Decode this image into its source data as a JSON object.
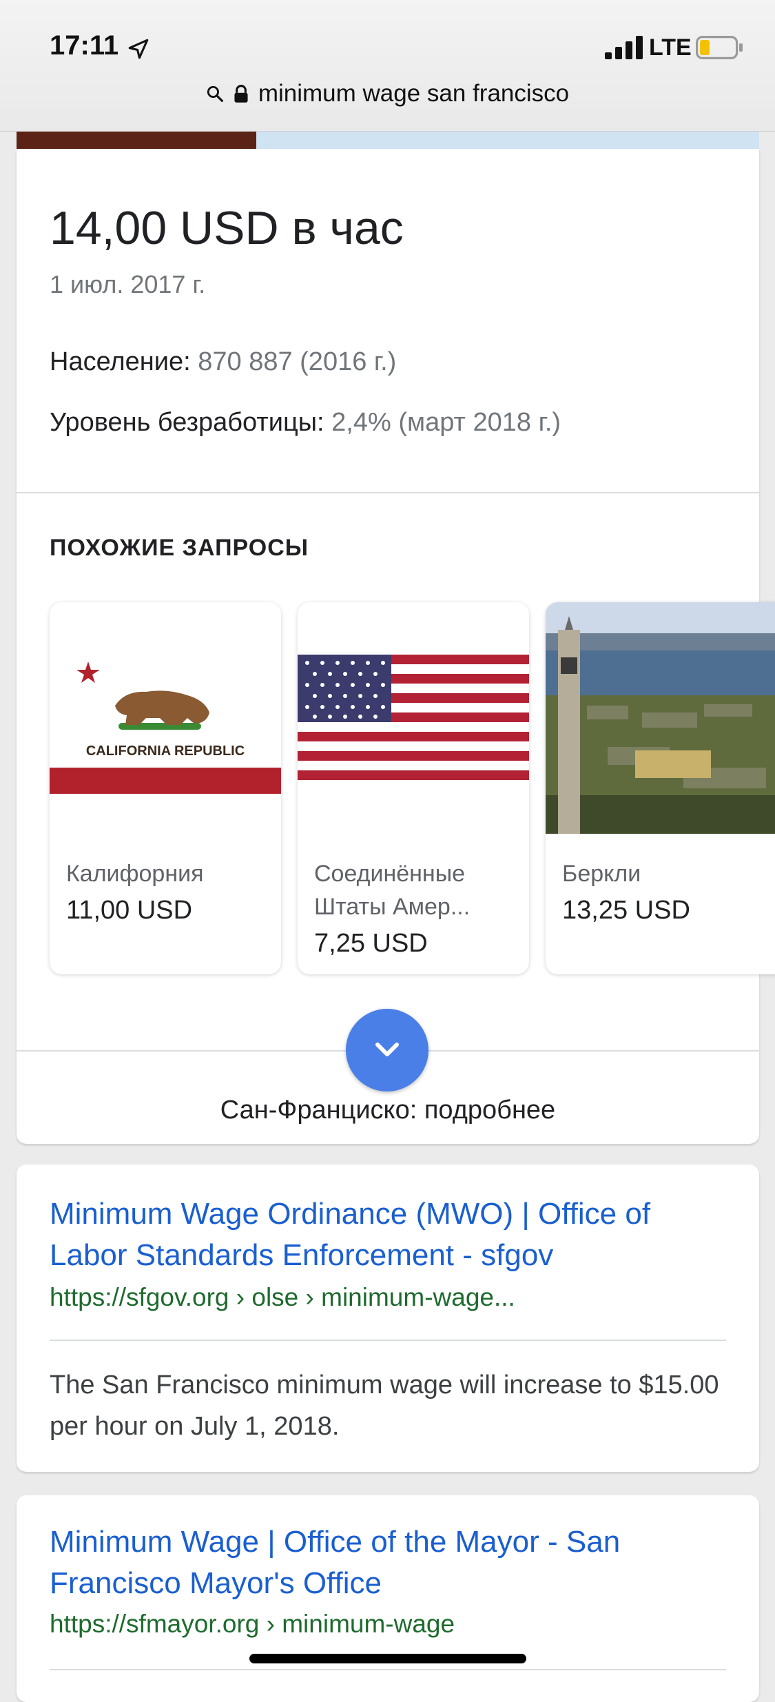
{
  "status": {
    "time": "17:11",
    "network": "LTE",
    "icons": [
      "location-arrow-icon",
      "signal-icon",
      "battery-icon"
    ]
  },
  "url_bar": {
    "query": "minimum wage san francisco",
    "icons": [
      "search-icon",
      "lock-icon"
    ]
  },
  "answer": {
    "value": "14,00 USD в час",
    "date": "1 июл. 2017 г.",
    "population_label": "Население:",
    "population_value": "870 887 (2016 г.)",
    "unemployment_label": "Уровень безработицы:",
    "unemployment_value": "2,4% (март 2018 г.)"
  },
  "related": {
    "title": "ПОХОЖИЕ ЗАПРОСЫ",
    "items": [
      {
        "name": "Калифорния",
        "value": "11,00 USD",
        "image_text": "CALIFORNIA REPUBLIC"
      },
      {
        "name": "Соединённые Штаты Амер...",
        "value": "7,25 USD"
      },
      {
        "name": "Беркли",
        "value": "13,25 USD"
      }
    ]
  },
  "more": {
    "label": "Сан-Франциско: подробнее",
    "icon": "chevron-down-icon"
  },
  "results": [
    {
      "title": "Minimum Wage Ordinance (MWO) | Office of Labor Standards Enforcement - sfgov",
      "url": "https://sfgov.org › olse › minimum-wage...",
      "snippet": "The San Francisco minimum wage will increase to $15.00 per hour on July 1, 2018."
    },
    {
      "title": "Minimum Wage | Office of the Mayor - San Francisco Mayor's Office",
      "url": "https://sfmayor.org › minimum-wage"
    }
  ],
  "colors": {
    "link": "#1a5fd0",
    "url": "#1e6b2e",
    "accent_button": "#4a7fe8"
  }
}
